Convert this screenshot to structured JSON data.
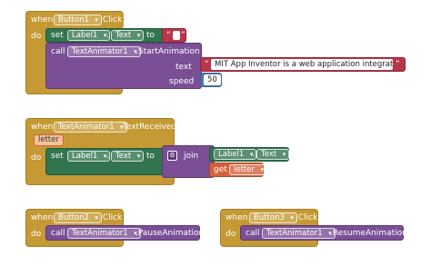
{
  "blocks": {
    "b1": {
      "when": "when",
      "component": "Button1",
      "event": ".Click",
      "do": "do",
      "set": "set",
      "target": "Label1",
      "prop": "Text",
      "to": "to",
      "quote_l": "“",
      "quote_r": "”",
      "call": "call",
      "animator": "TextAnimator1",
      "method": ".StartAnimation",
      "text_label": "text",
      "text_value": "MIT App Inventor is a web application integrated...",
      "speed_label": "speed",
      "speed_value": "50"
    },
    "b2": {
      "when": "when",
      "component": "TextAnimator1",
      "event": ".TextReceived",
      "param": "letter",
      "do": "do",
      "set": "set",
      "target": "Label1",
      "prop": "Text",
      "to": "to",
      "join": "join",
      "get_target": "Label1",
      "get_prop": "Text",
      "get": "get",
      "get_var": "letter"
    },
    "b3": {
      "when": "when",
      "component": "Button2",
      "event": ".Click",
      "do": "do",
      "call": "call",
      "animator": "TextAnimator1",
      "method": ".PauseAnimation"
    },
    "b4": {
      "when": "when",
      "component": "Button3",
      "event": ".Click",
      "do": "do",
      "call": "call",
      "animator": "TextAnimator1",
      "method": ".ResumeAnimation"
    }
  },
  "colors": {
    "event": "#c59a34",
    "setter": "#32744e",
    "component_call": "#7a4f95",
    "text": "#b8364a",
    "math": "#4a78b3",
    "variable": "#d4623a"
  },
  "dropdown_arrow": "▾"
}
